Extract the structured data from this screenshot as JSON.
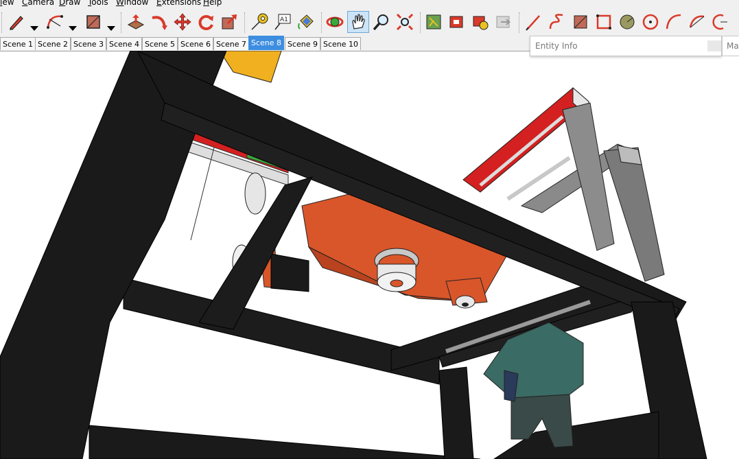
{
  "menu": [
    "iew",
    "Camera",
    "Draw",
    "Tools",
    "Window",
    "Extensions",
    "Help"
  ],
  "toolbar": {
    "tools": [
      {
        "icon": "pencil-icon"
      },
      {
        "icon": "arc-icon"
      },
      {
        "icon": "rectangle-icon"
      },
      {
        "icon": "push-pull-icon"
      },
      {
        "icon": "follow-me-icon"
      },
      {
        "icon": "move-icon"
      },
      {
        "icon": "rotate-icon"
      },
      {
        "icon": "scale-icon"
      },
      {
        "icon": "tape-measure-icon"
      },
      {
        "icon": "text-label-icon"
      },
      {
        "icon": "paint-bucket-icon"
      },
      {
        "icon": "orbit-icon"
      },
      {
        "icon": "pan-icon"
      },
      {
        "icon": "zoom-icon"
      },
      {
        "icon": "zoom-extents-icon"
      },
      {
        "icon": "add-location-icon"
      },
      {
        "icon": "warehouse-icon"
      },
      {
        "icon": "extension-warehouse-icon"
      },
      {
        "icon": "layout-icon"
      },
      {
        "icon": "draw-line-icon"
      },
      {
        "icon": "freehand-icon"
      },
      {
        "icon": "rect-2-icon"
      },
      {
        "icon": "rotated-rect-icon"
      },
      {
        "icon": "circle-icon"
      },
      {
        "icon": "polygon-icon"
      },
      {
        "icon": "arc-2-icon"
      },
      {
        "icon": "pie-icon"
      },
      {
        "icon": "arc-3-icon"
      }
    ]
  },
  "scenes": {
    "tabs": [
      "Scene 1",
      "Scene 2",
      "Scene 3",
      "Scene 4",
      "Scene 5",
      "Scene 6",
      "Scene 7",
      "Scene 8",
      "Scene 9",
      "Scene 10"
    ],
    "active": "Scene 8"
  },
  "panels": {
    "entity_info": "Entity Info",
    "materials_label": "Ma"
  },
  "colors": {
    "frame": "#1c1c1c",
    "motor_mount": "#d9562a",
    "rail_red": "#d42020",
    "rail_gray": "#7a7a7a",
    "active_tab": "#3d8ee0",
    "toolbar_bg": "#f0f0f0"
  }
}
